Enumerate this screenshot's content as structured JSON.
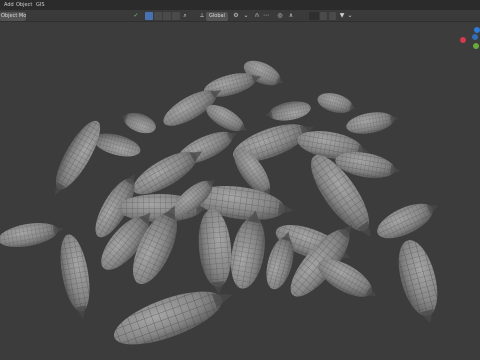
{
  "topbar": {
    "menus": [
      "Add",
      "Object",
      "GIS"
    ]
  },
  "toolbar": {
    "mode_label": "Object Mode",
    "orientation_label": "Global"
  },
  "colors": {
    "accent": "#4772b3",
    "axis_x": "#d33a4a",
    "axis_y": "#6aa83c",
    "axis_z": "#2e7bd6",
    "mesh_fill": "#8c8c8c",
    "wire": "#3a3a3a"
  },
  "icons": {
    "transform": "transform-icon",
    "snap": "snap-icon",
    "proportional": "proportional-editing-icon",
    "filter": "filter-icon",
    "search": "search-icon"
  }
}
